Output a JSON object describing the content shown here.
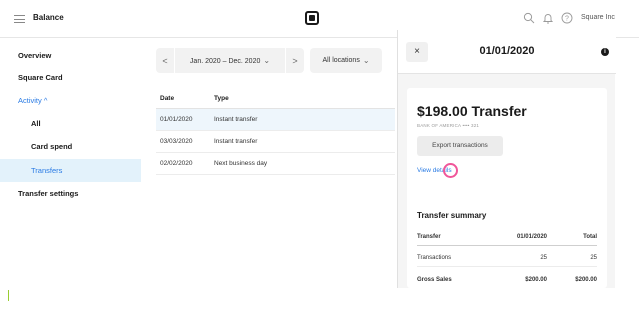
{
  "topbar": {
    "title": "Balance",
    "account": "Square Inc",
    "icons": [
      "menu-icon",
      "square-logo",
      "search-icon",
      "bell-icon",
      "help-icon"
    ]
  },
  "sidebar": {
    "items": [
      {
        "label": "Overview"
      },
      {
        "label": "Square Card"
      },
      {
        "label": "Activity ^"
      },
      {
        "label": "All"
      },
      {
        "label": "Card spend"
      },
      {
        "label": "Transfers"
      },
      {
        "label": "Transfer settings"
      }
    ]
  },
  "filters": {
    "prev": "<",
    "date_range": "Jan. 2020 – Dec. 2020",
    "next": ">",
    "locations": "All locations"
  },
  "table": {
    "headers": [
      "Date",
      "Type"
    ],
    "rows": [
      {
        "date": "01/01/2020",
        "type": "Instant transfer"
      },
      {
        "date": "03/03/2020",
        "type": "Instant transfer"
      },
      {
        "date": "02/02/2020",
        "type": "Next business day"
      }
    ]
  },
  "panel": {
    "close": "×",
    "date": "01/01/2020",
    "info": "i",
    "amount": "$198.00 Transfer",
    "bank": "BANK OF AMERICA •••• 321",
    "export_label": "Export transactions",
    "view_details": "View details",
    "summary": {
      "title": "Transfer summary",
      "headers": [
        "Transfer",
        "01/01/2020",
        "Total"
      ],
      "rows": [
        {
          "label": "Transactions",
          "value": "25",
          "total": "25"
        },
        {
          "label": "Gross Sales",
          "value": "$200.00",
          "total": "$200.00"
        }
      ]
    }
  },
  "colors": {
    "accent": "#2a7be4",
    "selected_bg": "#e3f2fb",
    "cursor": "#f0569a"
  }
}
